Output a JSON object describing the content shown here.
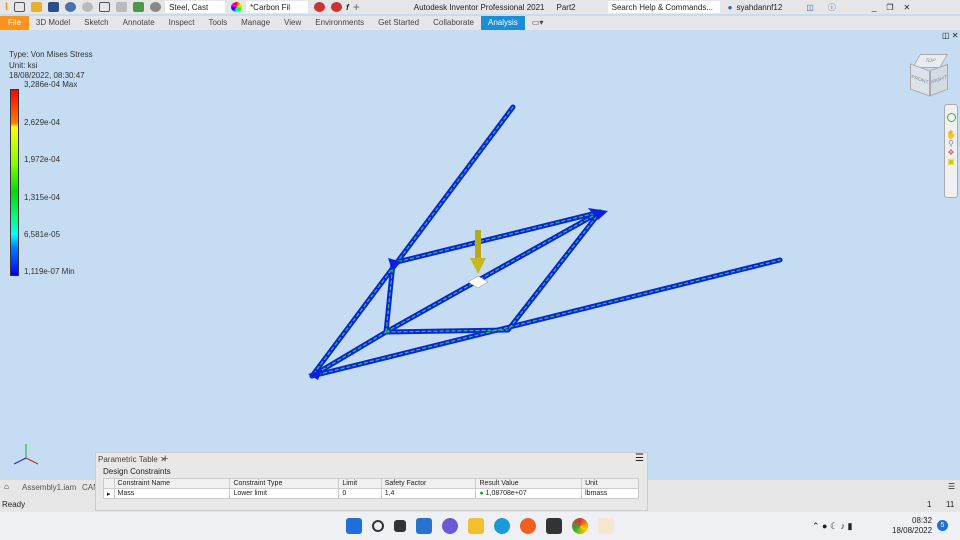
{
  "titlebar": {
    "material": "Steel, Cast",
    "appearance": "*Carbon Fil",
    "app_title": "Autodesk Inventor Professional 2021",
    "doc": "Part2",
    "search_placeholder": "Search Help & Commands...",
    "user": "syahdannf12"
  },
  "menu": [
    "File",
    "3D Model",
    "Sketch",
    "Annotate",
    "Inspect",
    "Tools",
    "Manage",
    "View",
    "Environments",
    "Get Started",
    "Collaborate",
    "Analysis"
  ],
  "legend": {
    "type": "Type: Von Mises Stress",
    "unit": "Unit: ksi",
    "datetime": "18/08/2022, 08:30:47",
    "ticks": [
      "3,286e-04 Max",
      "2,629e-04",
      "1,972e-04",
      "1,315e-04",
      "6,581e-05",
      "1,119e-07 Min"
    ]
  },
  "viewcube": {
    "front": "FRONT",
    "right": "RIGHT",
    "top": "TOP"
  },
  "ptable": {
    "tab": "Parametric Table",
    "group": "Design Constraints",
    "headers": [
      "Constraint Name",
      "Constraint Type",
      "Limit",
      "Safety Factor",
      "Result Value",
      "Unit"
    ],
    "row": [
      "Mass",
      "Lower limit",
      "0",
      "1,4",
      "1,08708e+07",
      "lbmass"
    ]
  },
  "status": {
    "tab1": "Assembly1.iam",
    "tab2": "CAN",
    "ready": "Ready",
    "n1": "1",
    "n2": "11"
  },
  "clock": {
    "time": "08:32",
    "date": "18/08/2022",
    "badge": "5"
  }
}
